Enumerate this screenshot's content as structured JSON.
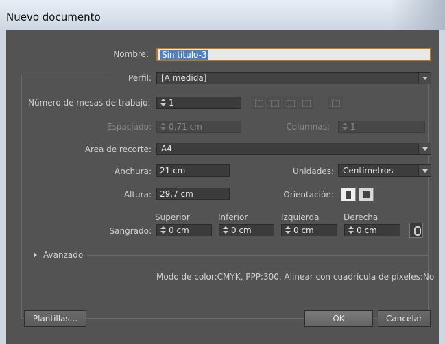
{
  "window": {
    "title": "Nuevo documento"
  },
  "name": {
    "label": "Nombre:",
    "value": "Sin título-3"
  },
  "profile": {
    "label": "Perfil:",
    "value": "[A medida]"
  },
  "artboards": {
    "label": "Número de mesas de trabajo:",
    "value": "1"
  },
  "spacing": {
    "label": "Espaciado:",
    "value": "0,71 cm"
  },
  "columns": {
    "label": "Columnas:",
    "value": "1"
  },
  "crop": {
    "label": "Área de recorte:",
    "value": "A4"
  },
  "width": {
    "label": "Anchura:",
    "value": "21 cm"
  },
  "units": {
    "label": "Unidades:",
    "value": "Centímetros"
  },
  "height": {
    "label": "Altura:",
    "value": "29,7 cm"
  },
  "orientation": {
    "label": "Orientación:"
  },
  "bleed": {
    "label": "Sangrado:",
    "top": {
      "label": "Superior",
      "value": "0 cm"
    },
    "bottom": {
      "label": "Inferior",
      "value": "0 cm"
    },
    "left": {
      "label": "Izquierda",
      "value": "0 cm"
    },
    "right": {
      "label": "Derecha",
      "value": "0 cm"
    }
  },
  "advanced": {
    "label": "Avanzado"
  },
  "summary": "Modo de color:CMYK, PPP:300, Alinear con cuadrícula de píxeles:No",
  "buttons": {
    "templates": "Plantillas...",
    "ok": "OK",
    "cancel": "Cancelar"
  },
  "icons": {
    "arrange": [
      "grid-by-row-icon",
      "grid-by-column-icon",
      "arrange-by-row-icon",
      "arrange-by-column-icon",
      "right-to-left-icon"
    ],
    "orientation": [
      "portrait-icon",
      "landscape-icon"
    ],
    "link": "chain-link-icon",
    "disclosure": "disclosure-triangle-icon"
  },
  "colors": {
    "background": "#535353",
    "highlight": "#4f7fbf"
  }
}
